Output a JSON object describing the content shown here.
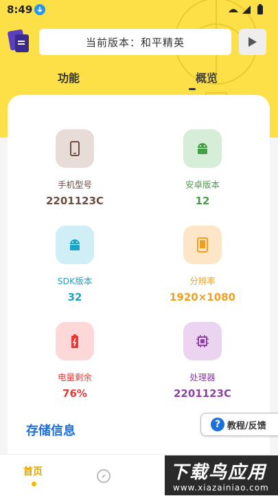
{
  "status_bar": {
    "time": "8:49"
  },
  "header": {
    "version_text": "当前版本：和平精英"
  },
  "tabs": [
    {
      "label": "功能"
    },
    {
      "label": "概览"
    }
  ],
  "items": [
    {
      "label": "手机型号",
      "value": "2201123C",
      "color": "#6d4c41",
      "bg": "#e7dcd8",
      "icon": "phone-icon"
    },
    {
      "label": "安卓版本",
      "value": "12",
      "color": "#43a047",
      "bg": "#d6eed8",
      "icon": "android-icon"
    },
    {
      "label": "SDK版本",
      "value": "32",
      "color": "#1aa5c8",
      "bg": "#cfeef6",
      "icon": "android-icon"
    },
    {
      "label": "分辨率",
      "value": "1920×1080",
      "color": "#f2a01b",
      "bg": "#fde6c8",
      "icon": "screen-icon"
    },
    {
      "label": "电量剩余",
      "value": "76%",
      "color": "#e53935",
      "bg": "#fcd8d8",
      "icon": "battery-icon"
    },
    {
      "label": "处理器",
      "value": "2201123C",
      "color": "#8e3fa8",
      "bg": "#ead4ef",
      "icon": "cpu-icon"
    }
  ],
  "storage_title": "存储信息",
  "help_button": {
    "q": "?",
    "label": "教程/反馈"
  },
  "nav": {
    "home": "首页"
  },
  "watermark": {
    "title": "下载鸟应用",
    "url": "www.xiazainiao.com"
  }
}
